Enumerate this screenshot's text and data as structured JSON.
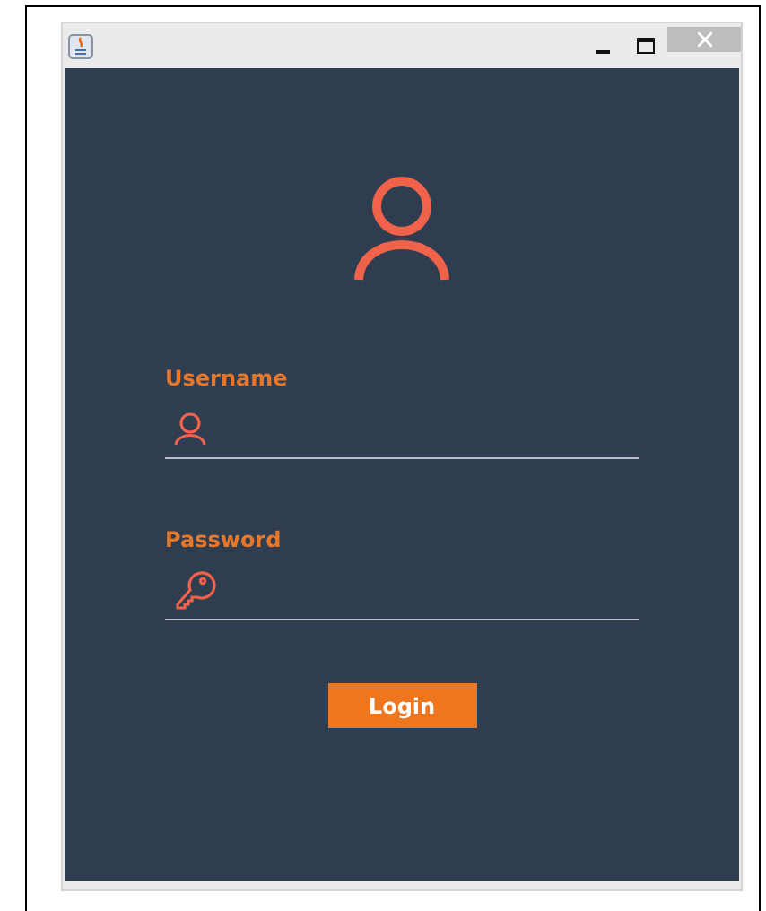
{
  "form": {
    "fields": [
      {
        "kind": "user",
        "label": "Username"
      },
      {
        "kind": "key",
        "label": "Password"
      }
    ],
    "button": "Login"
  }
}
